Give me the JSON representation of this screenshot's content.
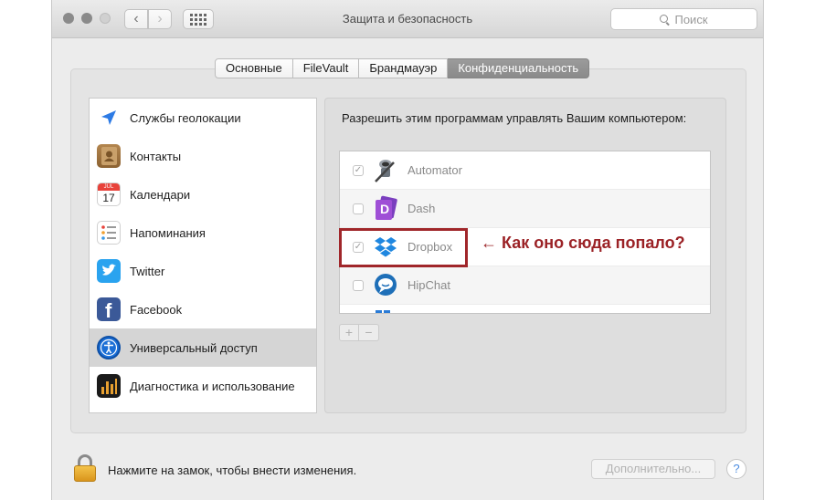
{
  "window": {
    "title": "Защита и безопасность"
  },
  "toolbar": {
    "back_glyph": "‹",
    "forward_glyph": "›",
    "search_placeholder": "Поиск"
  },
  "tabs": [
    {
      "label": "Основные",
      "active": false
    },
    {
      "label": "FileVault",
      "active": false
    },
    {
      "label": "Брандмауэр",
      "active": false
    },
    {
      "label": "Конфиденциальность",
      "active": true
    }
  ],
  "sidebar": {
    "items": [
      {
        "label": "Службы геолокации",
        "icon": "location-arrow-icon"
      },
      {
        "label": "Контакты",
        "icon": "contacts-book-icon"
      },
      {
        "label": "Календари",
        "icon": "calendar-icon",
        "icon_month": "JUL",
        "icon_day": "17"
      },
      {
        "label": "Напоминания",
        "icon": "reminders-list-icon"
      },
      {
        "label": "Twitter",
        "icon": "twitter-bird-icon"
      },
      {
        "label": "Facebook",
        "icon": "facebook-icon",
        "icon_glyph": "f"
      },
      {
        "label": "Универсальный доступ",
        "icon": "accessibility-icon",
        "selected": true
      },
      {
        "label": "Диагностика и использование",
        "icon": "diagnostics-icon"
      }
    ]
  },
  "main": {
    "heading": "Разрешить этим программам управлять Вашим компьютером:",
    "apps": [
      {
        "name": "Automator",
        "checked": true,
        "icon": "automator-robot-icon"
      },
      {
        "name": "Dash",
        "checked": false,
        "icon": "dash-icon",
        "icon_glyph": "D"
      },
      {
        "name": "Dropbox",
        "checked": true,
        "icon": "dropbox-icon"
      },
      {
        "name": "HipChat",
        "checked": false,
        "icon": "hipchat-icon"
      }
    ],
    "check_glyph": "✓",
    "add_label": "+",
    "remove_label": "−",
    "annotation": "← Как оно сюда попало?"
  },
  "footer": {
    "lock_text": "Нажмите на замок, чтобы внести изменения.",
    "advanced_label": "Дополнительно...",
    "help_label": "?"
  },
  "colors": {
    "highlight_border": "#a0262a",
    "annotation_text": "#9b2226",
    "active_tab": "#8f8f8f"
  }
}
